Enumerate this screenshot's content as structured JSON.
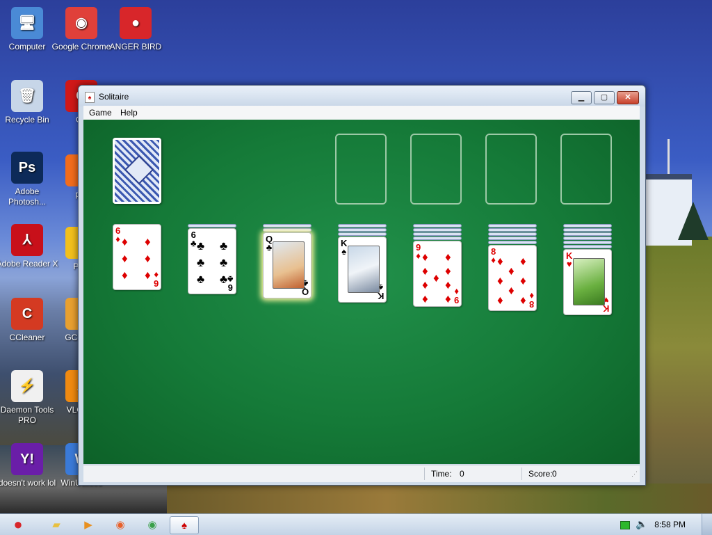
{
  "desktop": {
    "icons": [
      {
        "label": "Computer",
        "glyph": "🖥",
        "color": "#4a8ad6"
      },
      {
        "label": "Google Chrome",
        "glyph": "◉",
        "color": "#e0403a"
      },
      {
        "label": "ANGER BIRD",
        "glyph": "●",
        "color": "#d8262a"
      },
      {
        "label": "Recycle Bin",
        "glyph": "🗑",
        "color": "#c7d6e8"
      },
      {
        "label": "Op",
        "glyph": "O",
        "color": "#d01818"
      },
      {
        "label": "Adobe Photosh...",
        "glyph": "Ps",
        "color": "#0d2a59"
      },
      {
        "label": "per",
        "glyph": "◐",
        "color": "#f26c1c"
      },
      {
        "label": "Adobe Reader X",
        "glyph": "⅄",
        "color": "#c8101a"
      },
      {
        "label": "Pow",
        "glyph": "◑",
        "color": "#f2c01c"
      },
      {
        "label": "CCleaner",
        "glyph": "C",
        "color": "#d43a22"
      },
      {
        "label": "GC GAD",
        "glyph": "▮",
        "color": "#e8a030"
      },
      {
        "label": "Daemon Tools PRO",
        "glyph": "⚡",
        "color": "#f0f0f0"
      },
      {
        "label": "VLC pla",
        "glyph": "▲",
        "color": "#f08a10"
      },
      {
        "label": "doesn't work lol",
        "glyph": "Y!",
        "color": "#6a1ea8"
      },
      {
        "label": "WinUtilities",
        "glyph": "W",
        "color": "#3a7ad8"
      }
    ]
  },
  "window": {
    "title": "Solitaire",
    "controls": {
      "minimize": "▁",
      "maximize": "▢",
      "close": "✕"
    },
    "menu": [
      "Game",
      "Help"
    ]
  },
  "game": {
    "tableau": [
      {
        "hidden": 0,
        "top": {
          "rank": "6",
          "suit": "♦",
          "color": "red"
        }
      },
      {
        "hidden": 1,
        "top": {
          "rank": "6",
          "suit": "♣",
          "color": "black"
        }
      },
      {
        "hidden": 2,
        "top": {
          "rank": "Q",
          "suit": "♣",
          "color": "black",
          "face": true,
          "selected": true
        }
      },
      {
        "hidden": 3,
        "top": {
          "rank": "K",
          "suit": "♠",
          "color": "black",
          "face": true
        }
      },
      {
        "hidden": 4,
        "top": {
          "rank": "9",
          "suit": "♦",
          "color": "red"
        }
      },
      {
        "hidden": 5,
        "top": {
          "rank": "8",
          "suit": "♦",
          "color": "red"
        }
      },
      {
        "hidden": 6,
        "top": {
          "rank": "K",
          "suit": "♥",
          "color": "red",
          "face": true
        }
      }
    ]
  },
  "status": {
    "time_label": "Time:",
    "time_value": "0",
    "score_label": "Score:",
    "score_value": "0"
  },
  "taskbar": {
    "items": [
      {
        "name": "angry-birds",
        "glyph": "●",
        "color": "#d8262a"
      },
      {
        "name": "explorer",
        "glyph": "📁",
        "color": "#e8c040"
      },
      {
        "name": "media-player",
        "glyph": "▶",
        "color": "#e89020"
      },
      {
        "name": "firefox",
        "glyph": "◉",
        "color": "#e8602a"
      },
      {
        "name": "chrome",
        "glyph": "◉",
        "color": "#3aa04a"
      },
      {
        "name": "solitaire",
        "glyph": "♠",
        "color": "#c00"
      }
    ],
    "clock": "8:58 PM"
  }
}
